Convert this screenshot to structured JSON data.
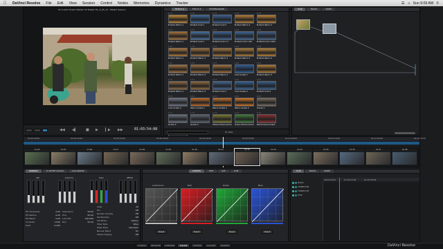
{
  "menubar": {
    "app": "DaVinci Resolve",
    "items": [
      "File",
      "Edit",
      "View",
      "Session",
      "Control",
      "Nodes",
      "Memories",
      "Dynamics",
      "Tracker"
    ],
    "clock": "Sun 9:09 AM"
  },
  "viewer": {
    "title": "Pro Lumix Power Stabler 47 Master FIL_4_05_13 - Master Session",
    "timecode": "01:03:54:08"
  },
  "gallery": {
    "tabs": [
      "STILLS 2",
      "STILLS 3",
      "POWERGRADE"
    ],
    "count_label": "51 stills",
    "stills": [
      {
        "num": "1.1.1",
        "label": "B-Start Warm 1",
        "color": "#c38a35"
      },
      {
        "num": "1.1.2",
        "label": "B-Start Cold 1",
        "color": "#3e6a9e"
      },
      {
        "num": "1.1.3",
        "label": "B-Start Cold 2",
        "color": "#3a6090"
      },
      {
        "num": "1.1.4",
        "label": "B-Start Warm 2",
        "color": "#b77e35"
      },
      {
        "num": "1.1.5",
        "label": "B-Start Warm 3",
        "color": "#bd8235"
      },
      {
        "num": "1.2.1",
        "label": "B-Start Warm 1",
        "color": "#a87338"
      },
      {
        "num": "1.2.2",
        "label": "B-Start Cold 1",
        "color": "#46709e"
      },
      {
        "num": "1.2.3",
        "label": "B-Start Cold 1 C",
        "color": "#3b6392"
      },
      {
        "num": "1.2.4",
        "label": "B-Start Cold 1 Db",
        "color": "#3d6595"
      },
      {
        "num": "1.2.5",
        "label": "B-Start Cold 1 Db2",
        "color": "#405f86"
      },
      {
        "num": "1.3.1",
        "label": "B-Start Warm 1",
        "color": "#b07a3a"
      },
      {
        "num": "1.3.2",
        "label": "B-Start Warm 1",
        "color": "#9b7040"
      },
      {
        "num": "1.3.3",
        "label": "B-Start Warm 2",
        "color": "#a4763c"
      },
      {
        "num": "1.3.4",
        "label": "B-Start Warm 3",
        "color": "#ad7d3a"
      },
      {
        "num": "1.3.5",
        "label": "B-Start Warm 4",
        "color": "#b68238"
      },
      {
        "num": "1.4.1",
        "label": "B-Start Warm 1",
        "color": "#a47440"
      },
      {
        "num": "1.4.2",
        "label": "B-Start Warm 2",
        "color": "#9a6d3e"
      },
      {
        "num": "1.4.3",
        "label": "B-Start Warm 2",
        "color": "#a37340"
      },
      {
        "num": "1.4.4",
        "label": "Cool Grade 1",
        "color": "#2d5d98"
      },
      {
        "num": "1.4.5",
        "label": "B-Start Warm 3",
        "color": "#b27c36"
      },
      {
        "num": "1.5.1",
        "label": "B-Start Warm 1",
        "color": "#8e6a44"
      },
      {
        "num": "1.5.2",
        "label": "B-Start Warm 2",
        "color": "#93693e"
      },
      {
        "num": "1.5.3",
        "label": "B-Start Cold 1",
        "color": "#3f6694"
      },
      {
        "num": "1.5.4",
        "label": "Cool Grade 2",
        "color": "#35649a"
      },
      {
        "num": "1.5.5",
        "label": "B-Start Cold 2",
        "color": "#365f8c"
      },
      {
        "num": "1.6.1",
        "label": "Cool Grade 3",
        "color": "#6d7684"
      },
      {
        "num": "1.6.2",
        "label": "Warm Grade 1",
        "color": "#c06a28"
      },
      {
        "num": "1.6.3",
        "label": "Warm Grade 2",
        "color": "#c2702a"
      },
      {
        "num": "1.6.4",
        "label": "Warm Grade 3",
        "color": "#d0782a"
      },
      {
        "num": "1.6.5",
        "label": "Grade 1",
        "color": "#7a6e60"
      },
      {
        "num": "1.7.1",
        "label": "Grade 2",
        "color": "#697280"
      },
      {
        "num": "1.7.2",
        "label": "Grade 3",
        "color": "#5c6470"
      },
      {
        "num": "1.7.3",
        "label": "Yellow Enhancement",
        "color": "#7a7a30"
      },
      {
        "num": "1.7.4",
        "label": "Green Enhancement",
        "color": "#3f7b3a"
      },
      {
        "num": "1.7.5",
        "label": "Red Enhancement",
        "color": "#8a2f2f"
      },
      {
        "num": "1.8.1",
        "label": "Blue Enhancement",
        "color": "#2c4f86"
      }
    ]
  },
  "node_editor": {
    "tabs": [
      "CLIP",
      "TRACK",
      "NODE"
    ]
  },
  "timeline": {
    "timecodes": [
      "01:00:00:00",
      "01:00:10:00",
      "01:00:20:00",
      "01:00:30:00",
      "01:00:40:00",
      "01:00:50:00",
      "01:01:00:00",
      "01:01:10:00",
      "01:01:20:00",
      "01:01:30:00"
    ],
    "clips": [
      {
        "id": "V1-24",
        "color": "#5b7050"
      },
      {
        "id": "V1-25",
        "color": "#8a7d66"
      },
      {
        "id": "V1-26",
        "color": "#6a7a88"
      },
      {
        "id": "V1-27",
        "color": "#746552"
      },
      {
        "id": "V1-28",
        "color": "#7a6a5a"
      },
      {
        "id": "V1-29",
        "color": "#606e58"
      },
      {
        "id": "V1-30",
        "color": "#8c7a62"
      },
      {
        "id": "V1-31",
        "color": "#5e6a78"
      },
      {
        "id": "V1-32",
        "color": "#6e5f50"
      },
      {
        "id": "V1-33",
        "color": "#8a8678"
      },
      {
        "id": "V1-34",
        "color": "#5a6c58"
      },
      {
        "id": "V1-35",
        "color": "#7c6d5c"
      },
      {
        "id": "V1-36",
        "color": "#556a80"
      },
      {
        "id": "V1-37",
        "color": "#6d6656"
      },
      {
        "id": "V1-38",
        "color": "#485c70"
      }
    ]
  },
  "primaries": {
    "tabs": [
      "PRIMARY",
      "P. WHITE COLOR",
      "LOG GRADE"
    ],
    "groups": [
      "Lift",
      "Gamma",
      "Gain",
      "Offset"
    ],
    "params_left": [
      {
        "label": "HD Threshold",
        "value": "0.00"
      },
      {
        "label": "HD Radius",
        "value": "0.00"
      },
      {
        "label": "HD Blend",
        "value": "0.00"
      },
      {
        "label": "Contrast",
        "value": "1.000"
      },
      {
        "label": "Pivot",
        "value": "0.435"
      }
    ],
    "params_mid": [
      {
        "label": "Saturation",
        "value": "50.00"
      },
      {
        "label": "Hue",
        "value": "50.00"
      },
      {
        "label": "Lum Mix",
        "value": "100.000"
      },
      {
        "label": "Dim",
        "value": "50.00"
      }
    ],
    "params_right": [
      {
        "label": "Clips",
        "value": "All"
      },
      {
        "label": "Pin",
        "value": "Off"
      },
      {
        "label": "Render Overlay",
        "value": "Off"
      },
      {
        "label": "Set Number",
        "value": "Off"
      },
      {
        "label": "Set Mode",
        "value": "Gallery"
      },
      {
        "label": "Wipe Type",
        "value": "Wipe"
      },
      {
        "label": "Wipe Style",
        "value": "Gaussian"
      },
      {
        "label": "Banner Blend",
        "value": "On"
      },
      {
        "label": "Status Display",
        "value": "Off"
      }
    ]
  },
  "curves": {
    "tabs": [
      "CURVES",
      "HUE",
      "SAT",
      "LUM"
    ],
    "channels": [
      {
        "name": "Luminance",
        "color": "#bcbcbc"
      },
      {
        "name": "Red",
        "color": "#d81e24"
      },
      {
        "name": "Green",
        "color": "#1fa838"
      },
      {
        "name": "Blue",
        "color": "#2a54d6"
      }
    ],
    "reset_label": "Reset"
  },
  "keyframes": {
    "tabs": [
      "CLIP",
      "TRACK",
      "NODE"
    ],
    "timecodes": [
      "00:00:00:00",
      "01:03:54:08",
      "01:03:56:08"
    ],
    "rows": [
      "Master",
      "CORRECTOR",
      "CORRECTOR",
      "PCSS"
    ]
  },
  "footer": {
    "tabs": [
      "CONFIG",
      "BROWSE",
      "CONFORM",
      "COLOR",
      "VIEWER",
      "GALLERY",
      "FORMAT"
    ],
    "active": "COLOR",
    "brand": "DaVinci Resolve"
  }
}
